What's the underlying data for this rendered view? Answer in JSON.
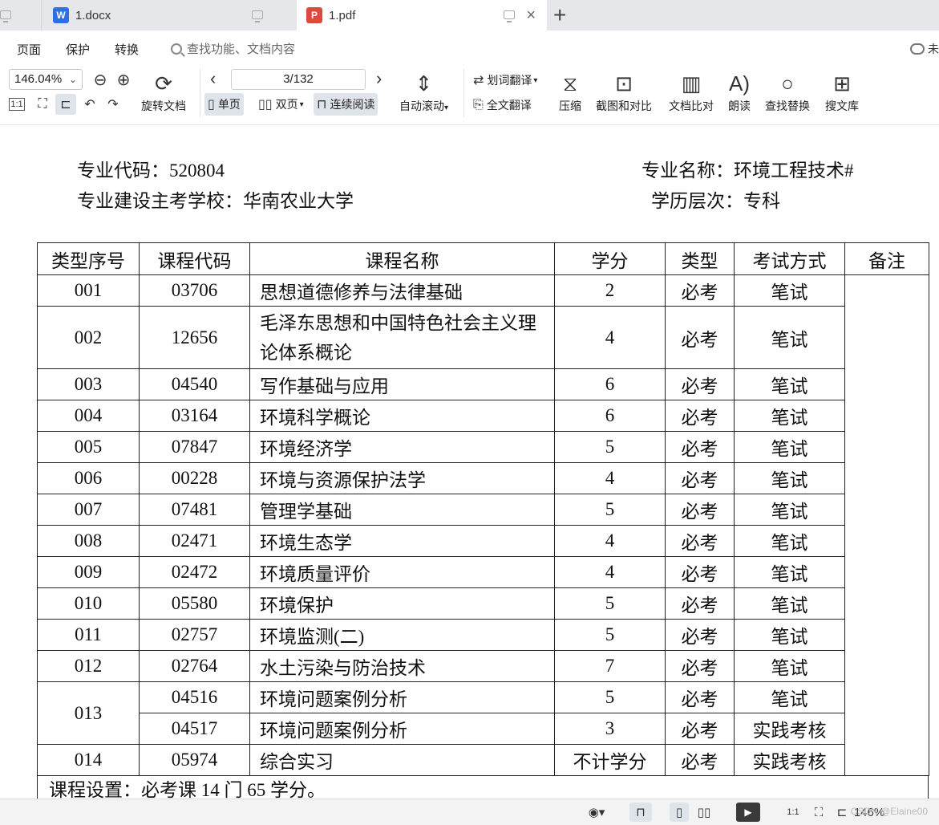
{
  "tabs": [
    {
      "label": "1.docx",
      "badge": "W",
      "color": "#2f6fe4"
    },
    {
      "label": "1.pdf",
      "badge": "P",
      "color": "#e0483e"
    }
  ],
  "menu": {
    "items": [
      "页面",
      "保护",
      "转换"
    ],
    "search_placeholder": "查找功能、文档内容",
    "cloud_label": "未"
  },
  "toolbar": {
    "zoom": "146.04%",
    "rotate_label": "旋转文档",
    "page_indicator": "3/132",
    "single_page": "单页",
    "double_page": "双页",
    "continuous": "连续阅读",
    "auto_scroll": "自动滚动",
    "word_translate": "划词翻译",
    "full_translate": "全文翻译",
    "compress": "压缩",
    "screenshot_compare": "截图和对比",
    "doc_compare": "文档比对",
    "read_aloud": "朗读",
    "find_replace": "查找替换",
    "search_library": "搜文库"
  },
  "document": {
    "major_code": "专业代码：520804",
    "major_name": "专业名称：环境工程技术#",
    "school": "专业建设主考学校：华南农业大学",
    "level": "学历层次：专科",
    "columns": [
      "类型序号",
      "课程代码",
      "课程名称",
      "学分",
      "类型",
      "考试方式",
      "备注"
    ],
    "rows": [
      {
        "seq": "001",
        "code": "03706",
        "name": "思想道德修养与法律基础",
        "credit": "2",
        "type": "必考",
        "exam": "笔试"
      },
      {
        "seq": "002",
        "code": "12656",
        "name": "毛泽东思想和中国特色社会主义理论体系概论",
        "credit": "4",
        "type": "必考",
        "exam": "笔试"
      },
      {
        "seq": "003",
        "code": "04540",
        "name": "写作基础与应用",
        "credit": "6",
        "type": "必考",
        "exam": "笔试"
      },
      {
        "seq": "004",
        "code": "03164",
        "name": "环境科学概论",
        "credit": "6",
        "type": "必考",
        "exam": "笔试"
      },
      {
        "seq": "005",
        "code": "07847",
        "name": "环境经济学",
        "credit": "5",
        "type": "必考",
        "exam": "笔试"
      },
      {
        "seq": "006",
        "code": "00228",
        "name": "环境与资源保护法学",
        "credit": "4",
        "type": "必考",
        "exam": "笔试"
      },
      {
        "seq": "007",
        "code": "07481",
        "name": "管理学基础",
        "credit": "5",
        "type": "必考",
        "exam": "笔试"
      },
      {
        "seq": "008",
        "code": "02471",
        "name": "环境生态学",
        "credit": "4",
        "type": "必考",
        "exam": "笔试"
      },
      {
        "seq": "009",
        "code": "02472",
        "name": "环境质量评价",
        "credit": "4",
        "type": "必考",
        "exam": "笔试"
      },
      {
        "seq": "010",
        "code": "05580",
        "name": "环境保护",
        "credit": "5",
        "type": "必考",
        "exam": "笔试"
      },
      {
        "seq": "011",
        "code": "02757",
        "name": "环境监测(二)",
        "credit": "5",
        "type": "必考",
        "exam": "笔试"
      },
      {
        "seq": "012",
        "code": "02764",
        "name": "水土污染与防治技术",
        "credit": "7",
        "type": "必考",
        "exam": "笔试"
      },
      {
        "seq": "013",
        "code": "04516",
        "name": "环境问题案例分析",
        "credit": "5",
        "type": "必考",
        "exam": "笔试"
      },
      {
        "seq": "",
        "code": "04517",
        "name": "环境问题案例分析",
        "credit": "3",
        "type": "必考",
        "exam": "实践考核"
      },
      {
        "seq": "014",
        "code": "05974",
        "name": "综合实习",
        "credit": "不计学分",
        "type": "必考",
        "exam": "实践考核"
      }
    ],
    "footer": "课程设置：必考课 14 门 65 学分。"
  },
  "statusbar": {
    "zoom": "146%",
    "watermark": "CSDN @Elaine00"
  }
}
